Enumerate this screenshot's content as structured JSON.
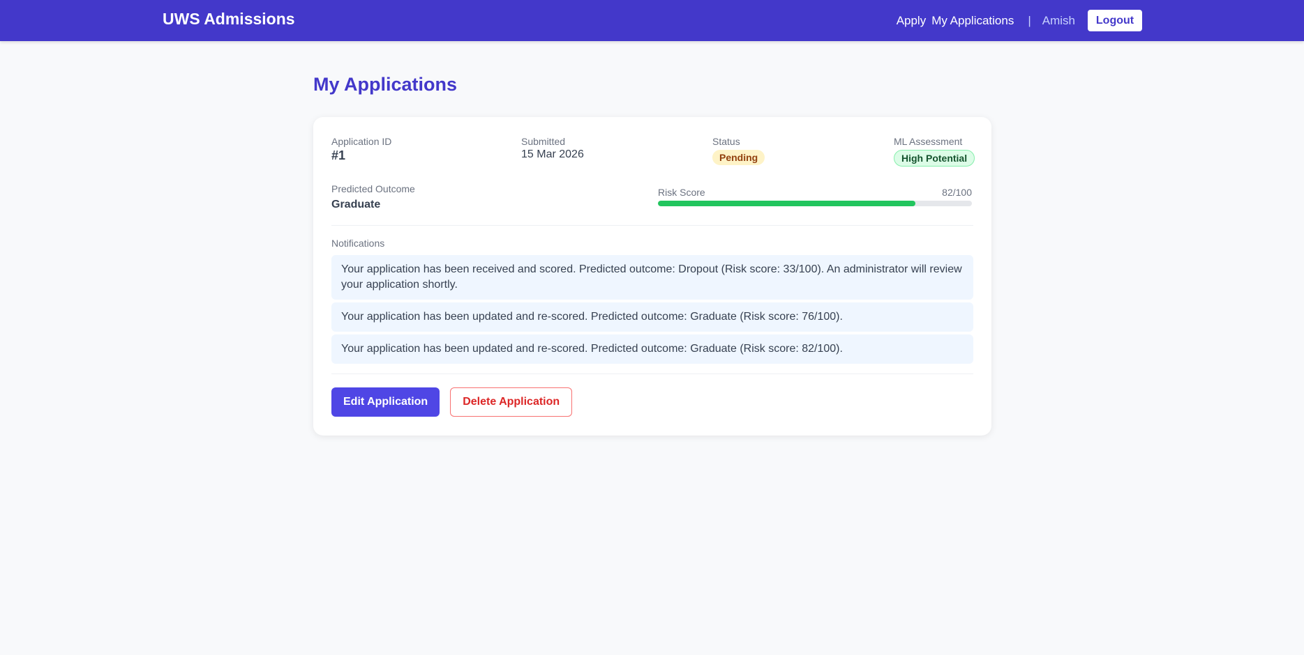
{
  "navbar": {
    "brand": "UWS Admissions",
    "links": [
      "Apply",
      "My Applications"
    ],
    "separator": "|",
    "user": "Amish",
    "logout_label": "Logout"
  },
  "page": {
    "title": "My Applications"
  },
  "application": {
    "id_label": "Application ID",
    "id_value": "#1",
    "submitted_label": "Submitted",
    "submitted_value": "15 Mar 2026",
    "status_label": "Status",
    "status_value": "Pending",
    "ml_label": "ML Assessment",
    "ml_value": "High Potential",
    "outcome_label": "Predicted Outcome",
    "outcome_value": "Graduate",
    "risk_label": "Risk Score",
    "risk_text": "82/100",
    "risk_score": 82,
    "risk_max": 100
  },
  "notifications": {
    "label": "Notifications",
    "items": [
      "Your application has been received and scored. Predicted outcome: Dropout (Risk score: 33/100). An administrator will review your application shortly.",
      "Your application has been updated and re-scored. Predicted outcome: Graduate (Risk score: 76/100).",
      "Your application has been updated and re-scored. Predicted outcome: Graduate (Risk score: 82/100)."
    ]
  },
  "actions": {
    "edit_label": "Edit Application",
    "delete_label": "Delete Application"
  },
  "colors": {
    "brand": "#4338ca",
    "primary_button": "#4f46e5",
    "danger": "#dc2626",
    "risk_fill": "#22c55e",
    "pending_badge": "#fef3c7",
    "potential_badge": "#dcfce7"
  }
}
